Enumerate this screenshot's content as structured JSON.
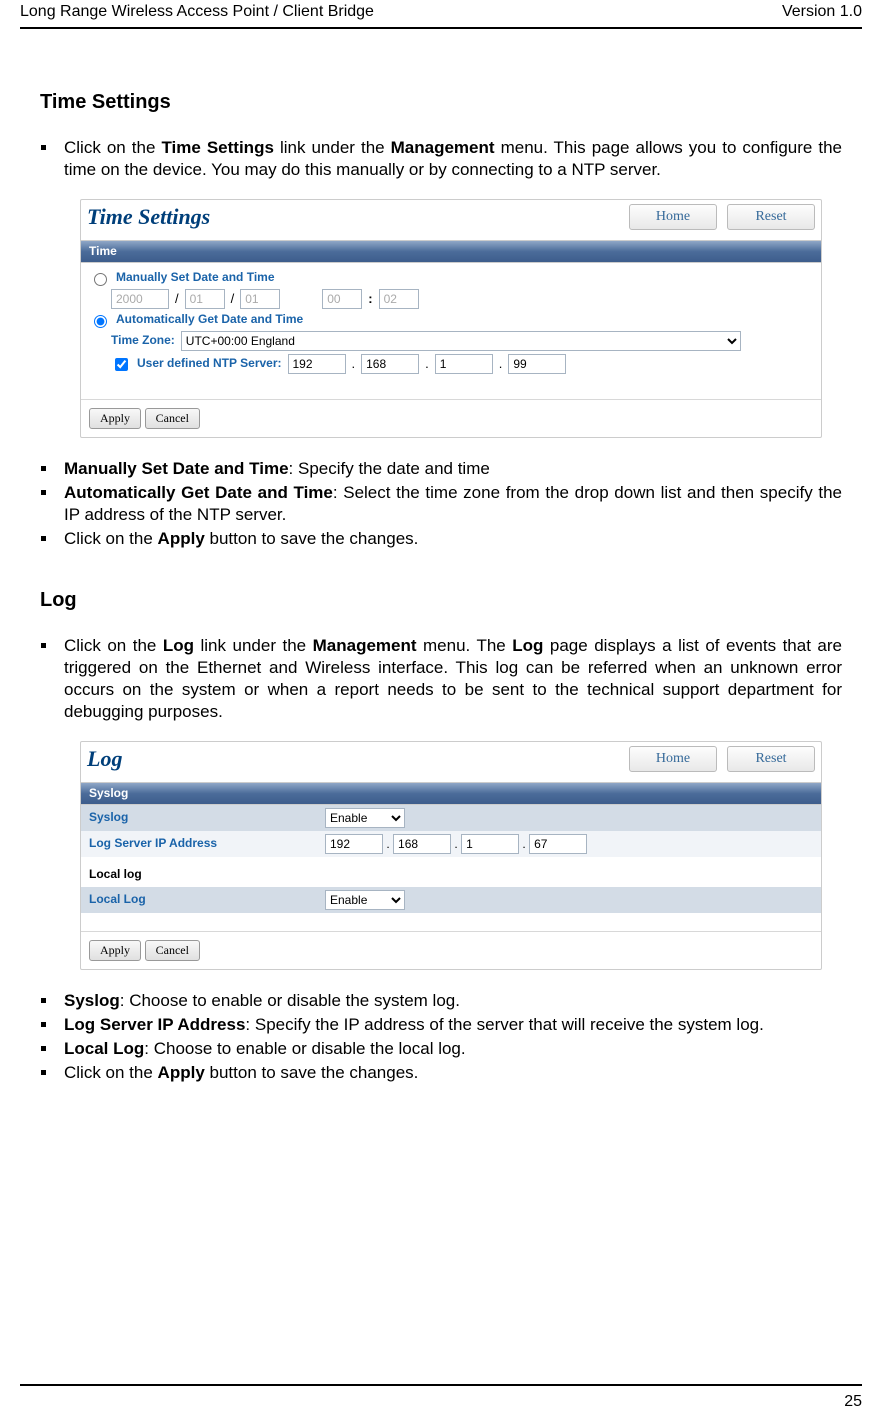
{
  "header": {
    "left": "Long Range Wireless Access Point / Client Bridge",
    "right": "Version 1.0"
  },
  "page_number": "25",
  "section1": {
    "heading": "Time Settings",
    "intro_prefix": "Click on the ",
    "intro_bold1": "Time Settings",
    "intro_mid": " link under the ",
    "intro_bold2": "Management",
    "intro_suffix": " menu. This page allows you to configure the time on the device. You may do this manually or by connecting to a NTP server.",
    "bullets": {
      "b1_bold": "Manually Set Date and Time",
      "b1_rest": ": Specify the date and time",
      "b2_bold": "Automatically Get Date and Time",
      "b2_rest": ": Select the time zone from the drop down list and then specify the IP address of the NTP server.",
      "b3_prefix": "Click on the ",
      "b3_bold": "Apply",
      "b3_suffix": " button to save the changes."
    }
  },
  "panel1": {
    "title": "Time Settings",
    "home": "Home",
    "reset": "Reset",
    "section_label": "Time",
    "manual_label": "Manually Set Date and Time",
    "year": "2000",
    "mon1": "01",
    "mon2": "01",
    "hh": "00",
    "mm": "02",
    "auto_label": "Automatically Get Date and Time",
    "tz_label": "Time Zone:",
    "tz_value": "UTC+00:00 England",
    "ntp_label": "User defined NTP Server:",
    "ntp": {
      "a": "192",
      "b": "168",
      "c": "1",
      "d": "99"
    },
    "apply": "Apply",
    "cancel": "Cancel"
  },
  "section2": {
    "heading": "Log",
    "intro_prefix": "Click on the ",
    "intro_b1": "Log",
    "intro_m1": " link under the ",
    "intro_b2": "Management",
    "intro_m2": " menu. The ",
    "intro_b3": "Log",
    "intro_suffix": " page displays a list of events that are triggered on the Ethernet and Wireless interface. This log can be referred when an unknown error occurs on the system or when a report needs to be sent to the technical support department for debugging purposes.",
    "bullets": {
      "b1_bold": "Syslog",
      "b1_rest": ": Choose to enable or disable the system log.",
      "b2_bold": "Log Server IP Address",
      "b2_rest": ": Specify the IP address of the server that will receive the system log.",
      "b3_bold": "Local Log",
      "b3_rest": ": Choose to enable or disable the local log.",
      "b4_prefix": "Click on the ",
      "b4_bold": "Apply",
      "b4_suffix": " button to save the changes."
    }
  },
  "panel2": {
    "title": "Log",
    "home": "Home",
    "reset": "Reset",
    "section_label": "Syslog",
    "syslog_row": "Syslog",
    "syslog_val": "Enable",
    "ip_row": "Log Server IP Address",
    "ip": {
      "a": "192",
      "b": "168",
      "c": "1",
      "d": "67"
    },
    "local_label": "Local log",
    "local_row": "Local Log",
    "local_val": "Enable",
    "apply": "Apply",
    "cancel": "Cancel"
  }
}
